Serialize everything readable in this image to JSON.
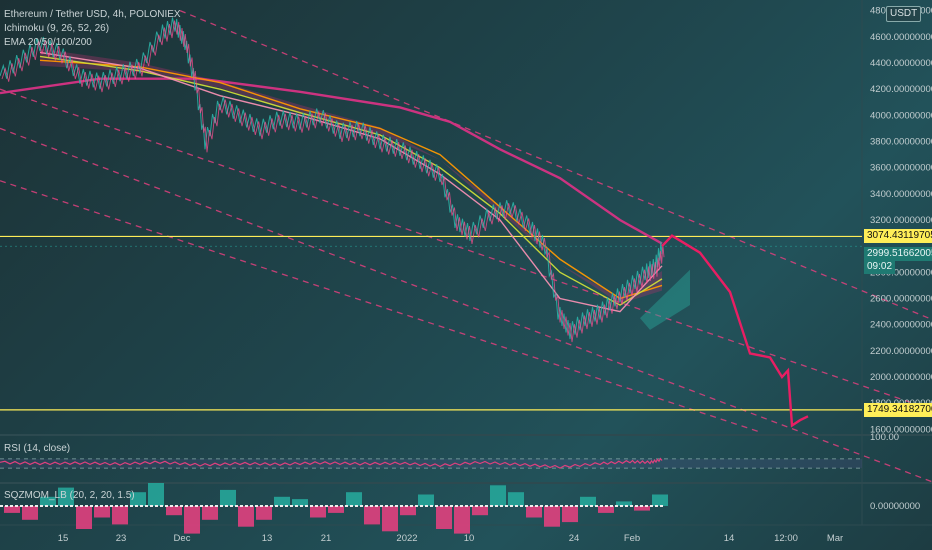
{
  "chart_data": {
    "type": "line",
    "title": "Ethereum / Tether USD, 4h, POLONIEX",
    "currency_badge": "USDT",
    "indicators": {
      "ichimoku": "Ichimoku (9, 26, 52, 26)",
      "ema": "EMA 20/50/100/200",
      "rsi": "RSI (14, close)",
      "sqzmom": "SQZMOM_LB (20, 2, 20, 1.5)"
    },
    "ylim": [
      1580,
      4820
    ],
    "y_ticks": [
      "4800.00000000",
      "4600.00000000",
      "4400.00000000",
      "4200.00000000",
      "4000.00000000",
      "3800.00000000",
      "3600.00000000",
      "3400.00000000",
      "3200.00000000",
      "2800.00000000",
      "2600.00000000",
      "2400.00000000",
      "2200.00000000",
      "2000.00000000",
      "1800.00000000",
      "1600.00000000"
    ],
    "y_tick_values": [
      4800,
      4600,
      4400,
      4200,
      4000,
      3800,
      3600,
      3400,
      3200,
      2800,
      2600,
      2400,
      2200,
      2000,
      1800,
      1600
    ],
    "x_ticks": [
      {
        "label": "15",
        "x": 63
      },
      {
        "label": "23",
        "x": 121
      },
      {
        "label": "Dec",
        "x": 182
      },
      {
        "label": "13",
        "x": 267
      },
      {
        "label": "21",
        "x": 326
      },
      {
        "label": "2022",
        "x": 407
      },
      {
        "label": "10",
        "x": 469
      },
      {
        "label": "24",
        "x": 574
      },
      {
        "label": "Feb",
        "x": 632
      },
      {
        "label": "14",
        "x": 729
      },
      {
        "label": "12:00",
        "x": 786
      },
      {
        "label": "Mar",
        "x": 835
      }
    ],
    "horizontal_levels": [
      {
        "value": 3074.43119705,
        "label": "3074.43119705",
        "color": "#ffee58"
      },
      {
        "value": 1749.341827,
        "label": "1749.34182700",
        "color": "#ffee58"
      }
    ],
    "last_price": {
      "value": 2999.51662005,
      "label": "2999.51662005",
      "countdown": "09:02",
      "color": "#26a69a"
    },
    "price_series": [
      {
        "x": 0,
        "y": 4300
      },
      {
        "x": 20,
        "y": 4420
      },
      {
        "x": 40,
        "y": 4550
      },
      {
        "x": 60,
        "y": 4480
      },
      {
        "x": 80,
        "y": 4300
      },
      {
        "x": 100,
        "y": 4260
      },
      {
        "x": 120,
        "y": 4320
      },
      {
        "x": 140,
        "y": 4380
      },
      {
        "x": 160,
        "y": 4620
      },
      {
        "x": 175,
        "y": 4700
      },
      {
        "x": 185,
        "y": 4560
      },
      {
        "x": 195,
        "y": 4250
      },
      {
        "x": 205,
        "y": 3800
      },
      {
        "x": 220,
        "y": 4100
      },
      {
        "x": 240,
        "y": 4000
      },
      {
        "x": 260,
        "y": 3900
      },
      {
        "x": 280,
        "y": 3980
      },
      {
        "x": 300,
        "y": 3950
      },
      {
        "x": 320,
        "y": 4000
      },
      {
        "x": 340,
        "y": 3880
      },
      {
        "x": 360,
        "y": 3900
      },
      {
        "x": 380,
        "y": 3800
      },
      {
        "x": 400,
        "y": 3750
      },
      {
        "x": 420,
        "y": 3650
      },
      {
        "x": 440,
        "y": 3550
      },
      {
        "x": 455,
        "y": 3200
      },
      {
        "x": 470,
        "y": 3100
      },
      {
        "x": 490,
        "y": 3250
      },
      {
        "x": 510,
        "y": 3300
      },
      {
        "x": 530,
        "y": 3150
      },
      {
        "x": 545,
        "y": 3000
      },
      {
        "x": 558,
        "y": 2500
      },
      {
        "x": 570,
        "y": 2350
      },
      {
        "x": 585,
        "y": 2450
      },
      {
        "x": 600,
        "y": 2500
      },
      {
        "x": 615,
        "y": 2600
      },
      {
        "x": 630,
        "y": 2700
      },
      {
        "x": 645,
        "y": 2800
      },
      {
        "x": 655,
        "y": 2850
      },
      {
        "x": 662,
        "y": 2999
      }
    ],
    "ema_series": [
      {
        "name": "EMA 200",
        "color": "#d63384",
        "points": [
          {
            "x": 0,
            "y": 4170
          },
          {
            "x": 100,
            "y": 4280
          },
          {
            "x": 200,
            "y": 4280
          },
          {
            "x": 300,
            "y": 4180
          },
          {
            "x": 400,
            "y": 4060
          },
          {
            "x": 450,
            "y": 3950
          },
          {
            "x": 500,
            "y": 3740
          },
          {
            "x": 560,
            "y": 3520
          },
          {
            "x": 620,
            "y": 3200
          },
          {
            "x": 662,
            "y": 3020
          }
        ]
      },
      {
        "name": "EMA 100",
        "color": "#ff9800",
        "points": [
          {
            "x": 40,
            "y": 4420
          },
          {
            "x": 140,
            "y": 4370
          },
          {
            "x": 220,
            "y": 4250
          },
          {
            "x": 300,
            "y": 4050
          },
          {
            "x": 380,
            "y": 3900
          },
          {
            "x": 440,
            "y": 3700
          },
          {
            "x": 500,
            "y": 3300
          },
          {
            "x": 560,
            "y": 2900
          },
          {
            "x": 620,
            "y": 2600
          },
          {
            "x": 662,
            "y": 2700
          }
        ]
      },
      {
        "name": "EMA 50",
        "color": "#cddc39",
        "points": [
          {
            "x": 40,
            "y": 4450
          },
          {
            "x": 140,
            "y": 4340
          },
          {
            "x": 220,
            "y": 4200
          },
          {
            "x": 300,
            "y": 4020
          },
          {
            "x": 380,
            "y": 3850
          },
          {
            "x": 440,
            "y": 3600
          },
          {
            "x": 500,
            "y": 3250
          },
          {
            "x": 560,
            "y": 2800
          },
          {
            "x": 620,
            "y": 2550
          },
          {
            "x": 662,
            "y": 2750
          }
        ]
      },
      {
        "name": "EMA 20",
        "color": "#f48fb1",
        "points": [
          {
            "x": 40,
            "y": 4480
          },
          {
            "x": 140,
            "y": 4360
          },
          {
            "x": 220,
            "y": 4150
          },
          {
            "x": 300,
            "y": 4000
          },
          {
            "x": 380,
            "y": 3820
          },
          {
            "x": 440,
            "y": 3550
          },
          {
            "x": 500,
            "y": 3200
          },
          {
            "x": 560,
            "y": 2600
          },
          {
            "x": 620,
            "y": 2500
          },
          {
            "x": 662,
            "y": 2850
          }
        ]
      }
    ],
    "forecast_path": [
      {
        "x": 662,
        "y": 3000
      },
      {
        "x": 672,
        "y": 3080
      },
      {
        "x": 700,
        "y": 2950
      },
      {
        "x": 730,
        "y": 2650
      },
      {
        "x": 750,
        "y": 2180
      },
      {
        "x": 770,
        "y": 2150
      },
      {
        "x": 782,
        "y": 2000
      },
      {
        "x": 788,
        "y": 2050
      },
      {
        "x": 792,
        "y": 1630
      },
      {
        "x": 800,
        "y": 1670
      },
      {
        "x": 808,
        "y": 1700
      }
    ],
    "channel_lines": [
      {
        "x1": 180,
        "v1": 4800,
        "x2": 932,
        "v2": 2440
      },
      {
        "x1": 0,
        "v1": 4200,
        "x2": 932,
        "v2": 1750
      },
      {
        "x1": 0,
        "v1": 3900,
        "x2": 932,
        "v2": 1200
      },
      {
        "x1": 0,
        "v1": 3500,
        "x2": 760,
        "v2": 1580
      }
    ],
    "rsi": {
      "ylim": [
        0,
        100
      ],
      "y_ticks": [
        "100.00"
      ],
      "points": [
        {
          "x": 0,
          "y": 55
        },
        {
          "x": 40,
          "y": 50
        },
        {
          "x": 80,
          "y": 52
        },
        {
          "x": 120,
          "y": 48
        },
        {
          "x": 160,
          "y": 56
        },
        {
          "x": 200,
          "y": 44
        },
        {
          "x": 240,
          "y": 50
        },
        {
          "x": 280,
          "y": 47
        },
        {
          "x": 320,
          "y": 53
        },
        {
          "x": 360,
          "y": 49
        },
        {
          "x": 400,
          "y": 51
        },
        {
          "x": 440,
          "y": 42
        },
        {
          "x": 480,
          "y": 55
        },
        {
          "x": 520,
          "y": 46
        },
        {
          "x": 560,
          "y": 35
        },
        {
          "x": 600,
          "y": 50
        },
        {
          "x": 630,
          "y": 58
        },
        {
          "x": 650,
          "y": 55
        },
        {
          "x": 662,
          "y": 68
        }
      ]
    },
    "sqzmom": {
      "y_ticks": [
        "0.00000000"
      ],
      "bars": [
        {
          "x": 12,
          "v": -3
        },
        {
          "x": 30,
          "v": -6
        },
        {
          "x": 48,
          "v": 4
        },
        {
          "x": 66,
          "v": 8
        },
        {
          "x": 84,
          "v": -10
        },
        {
          "x": 102,
          "v": -5
        },
        {
          "x": 120,
          "v": -8
        },
        {
          "x": 138,
          "v": 6
        },
        {
          "x": 156,
          "v": 10
        },
        {
          "x": 174,
          "v": -4
        },
        {
          "x": 192,
          "v": -12
        },
        {
          "x": 210,
          "v": -6
        },
        {
          "x": 228,
          "v": 7
        },
        {
          "x": 246,
          "v": -9
        },
        {
          "x": 264,
          "v": -6
        },
        {
          "x": 282,
          "v": 4
        },
        {
          "x": 300,
          "v": 3
        },
        {
          "x": 318,
          "v": -5
        },
        {
          "x": 336,
          "v": -3
        },
        {
          "x": 354,
          "v": 6
        },
        {
          "x": 372,
          "v": -8
        },
        {
          "x": 390,
          "v": -11
        },
        {
          "x": 408,
          "v": -4
        },
        {
          "x": 426,
          "v": 5
        },
        {
          "x": 444,
          "v": -10
        },
        {
          "x": 462,
          "v": -12
        },
        {
          "x": 480,
          "v": -4
        },
        {
          "x": 498,
          "v": 9
        },
        {
          "x": 516,
          "v": 6
        },
        {
          "x": 534,
          "v": -5
        },
        {
          "x": 552,
          "v": -9
        },
        {
          "x": 570,
          "v": -7
        },
        {
          "x": 588,
          "v": 4
        },
        {
          "x": 606,
          "v": -3
        },
        {
          "x": 624,
          "v": 2
        },
        {
          "x": 642,
          "v": -2
        },
        {
          "x": 660,
          "v": 5
        }
      ]
    }
  }
}
